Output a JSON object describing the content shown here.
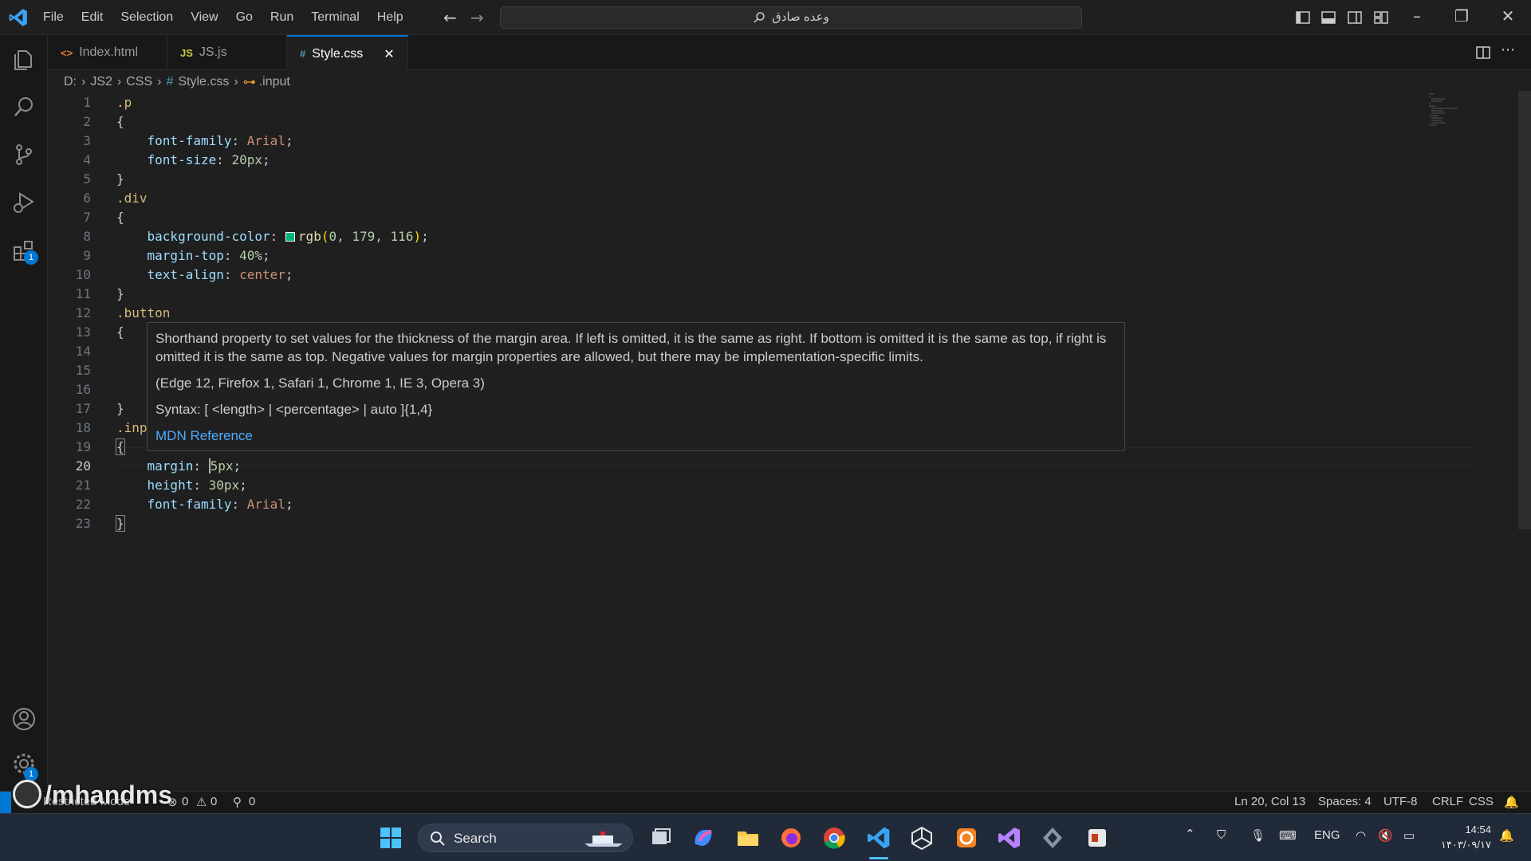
{
  "menu": [
    "File",
    "Edit",
    "Selection",
    "View",
    "Go",
    "Run",
    "Terminal",
    "Help"
  ],
  "command_center": {
    "text": "وعده صادق"
  },
  "tabs": [
    {
      "icon": "<>",
      "label": "Index.html"
    },
    {
      "icon": "JS",
      "label": "JS.js"
    },
    {
      "icon": "#",
      "label": "Style.css"
    }
  ],
  "breadcrumb": {
    "drive": "D:",
    "folder1": "JS2",
    "folder2": "CSS",
    "file": "Style.css",
    "symbol": ".input"
  },
  "activity_badge": "1",
  "settings_badge": "1",
  "code": {
    "l1": {
      "n": "1",
      "sel": ".p"
    },
    "l2": {
      "n": "2",
      "b": "{"
    },
    "l3": {
      "n": "3",
      "p": "font-family",
      "v": "Arial"
    },
    "l4": {
      "n": "4",
      "p": "font-size",
      "v": "20px"
    },
    "l5": {
      "n": "5",
      "b": "}"
    },
    "l6": {
      "n": "6",
      "sel": ".div"
    },
    "l7": {
      "n": "7",
      "b": "{"
    },
    "l8": {
      "n": "8",
      "p": "background-color",
      "fn": "rgb",
      "args": "0, 179, 116"
    },
    "l9": {
      "n": "9",
      "p": "margin-top",
      "v": "40%"
    },
    "l10": {
      "n": "10",
      "p": "text-align",
      "v": "center"
    },
    "l11": {
      "n": "11",
      "b": "}"
    },
    "l12": {
      "n": "12",
      "sel": ".button"
    },
    "l13": {
      "n": "13",
      "b": "{"
    },
    "l14": {
      "n": "14"
    },
    "l15": {
      "n": "15"
    },
    "l16": {
      "n": "16"
    },
    "l17": {
      "n": "17",
      "b": "}"
    },
    "l18": {
      "n": "18",
      "sel": ".inp"
    },
    "l19": {
      "n": "19",
      "b": "{"
    },
    "l20": {
      "n": "20",
      "p": "margin",
      "v": "5px"
    },
    "l21": {
      "n": "21",
      "p": "height",
      "v": "30px"
    },
    "l22": {
      "n": "22",
      "p": "font-family",
      "v": "Arial"
    },
    "l23": {
      "n": "23",
      "b": "}"
    }
  },
  "hover": {
    "description": "Shorthand property to set values for the thickness of the margin area. If left is omitted, it is the same as right. If bottom is omitted it is the same as top, if right is omitted it is the same as top. Negative values for margin properties are allowed, but there may be implementation-specific limits.",
    "browsers": "(Edge 12, Firefox 1, Safari 1, Chrome 1, IE 3, Opera 3)",
    "syntax": "Syntax: [ <length> | <percentage> | auto ]{1,4}",
    "link": "MDN Reference"
  },
  "status": {
    "restricted": "Restricted Mode",
    "errors": "0",
    "warnings": "0",
    "ports": "0",
    "position": "Ln 20, Col 13",
    "spaces": "Spaces: 4",
    "encoding": "UTF-8",
    "eol": "CRLF",
    "language": "CSS"
  },
  "watermark": "/mhandms",
  "taskbar": {
    "search": "Search",
    "lang": "ENG",
    "time": "14:54",
    "date": "۱۴۰۳/۰۹/۱۷"
  },
  "colors": {
    "accent": "#0078d4",
    "swatch": "#00b374"
  }
}
